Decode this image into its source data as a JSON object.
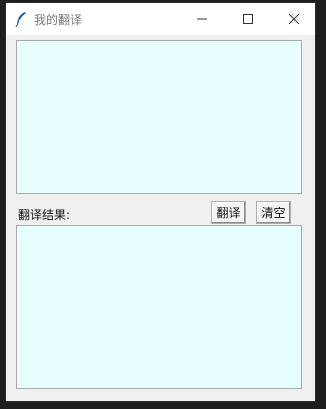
{
  "window": {
    "title": "我的翻译",
    "icons": {
      "app": "feather-icon",
      "minimize": "minimize-icon",
      "maximize": "maximize-icon",
      "close": "close-icon"
    }
  },
  "main": {
    "input_text": "",
    "result_label": "翻译结果:",
    "translate_button": "翻译",
    "clear_button": "清空",
    "output_text": ""
  },
  "colors": {
    "textbox_bg": "#e8ffff",
    "window_bg": "#f0f0f0"
  }
}
